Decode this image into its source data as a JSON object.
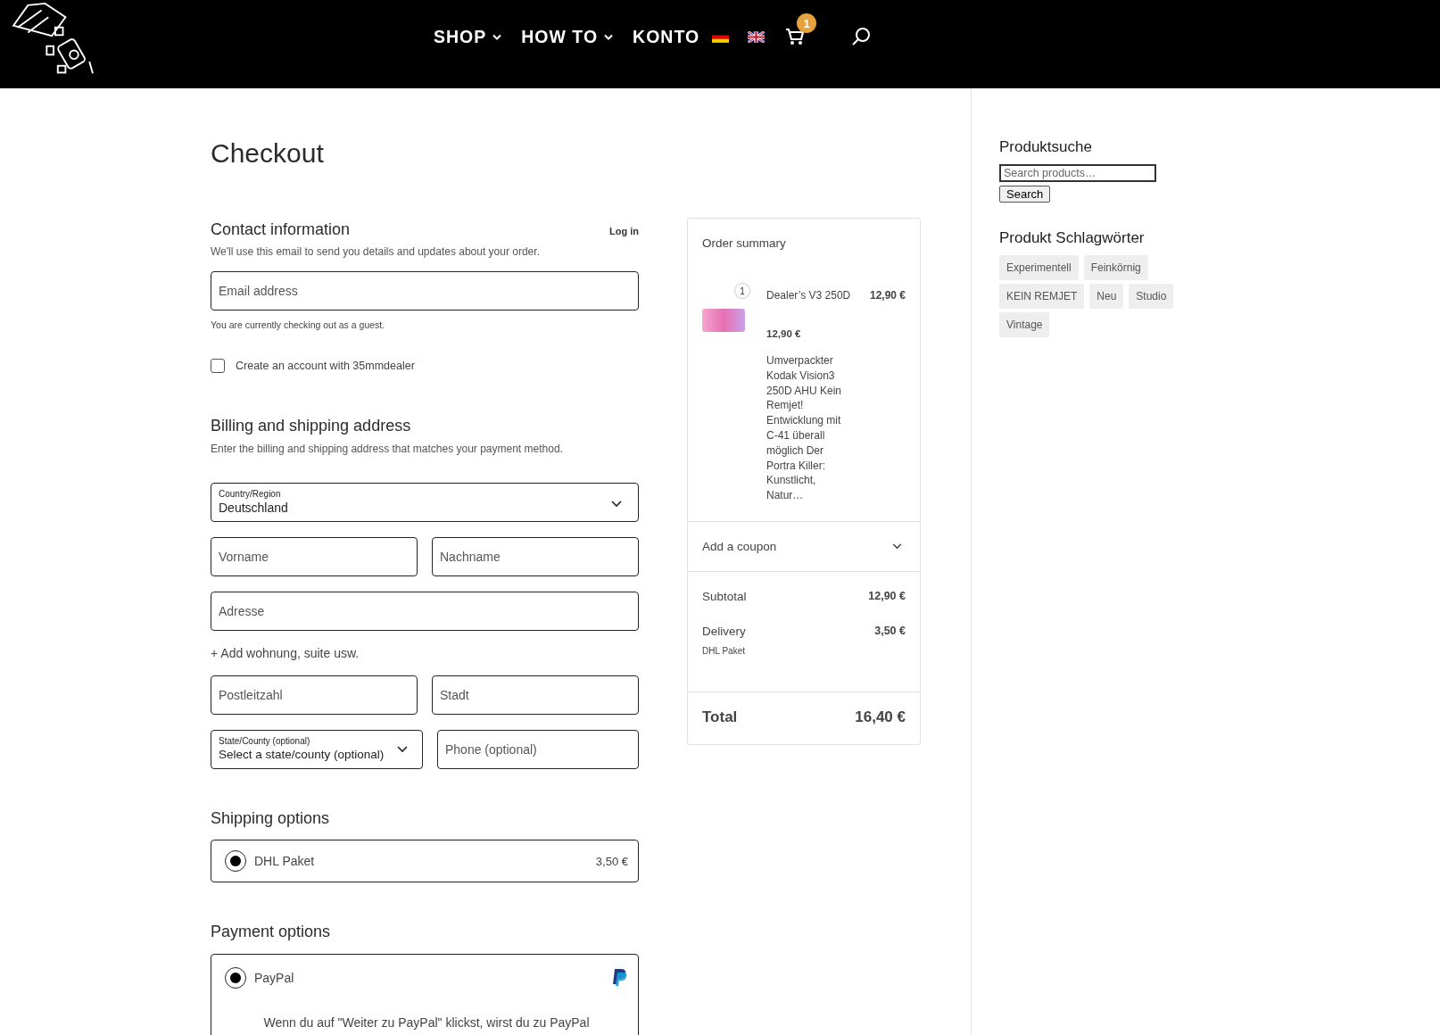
{
  "header": {
    "nav": [
      {
        "label": "SHOP",
        "kind": "dropdown"
      },
      {
        "label": "HOW TO",
        "kind": "dropdown"
      },
      {
        "label": "KONTO",
        "kind": "link"
      }
    ],
    "languages": [
      {
        "kind": "de"
      },
      {
        "kind": "uk"
      }
    ],
    "cart_count": "1"
  },
  "page_title": "Checkout",
  "contact": {
    "title": "Contact information",
    "log_in": "Log in",
    "description": "We'll use this email to send you details and updates about your order.",
    "email": {
      "placeholder": "Email address"
    },
    "guest_note": "You are currently checking out as a guest.",
    "create_account": {
      "label": "Create an account with 35mmdealer",
      "checked": false
    }
  },
  "billing": {
    "title": "Billing and shipping address",
    "description": "Enter the billing and shipping address that matches your payment method.",
    "rows": [
      [
        {
          "kind": "select",
          "label": "Country/Region",
          "value": "Deutschland"
        }
      ],
      [
        {
          "kind": "input",
          "placeholder": "Vorname"
        },
        {
          "kind": "input",
          "placeholder": "Nachname"
        }
      ],
      [
        {
          "kind": "input",
          "placeholder": "Adresse"
        }
      ],
      [
        {
          "kind": "link",
          "text": "+ Add wohnung, suite usw."
        }
      ],
      [
        {
          "kind": "input",
          "placeholder": "Postleitzahl"
        },
        {
          "kind": "input",
          "placeholder": "Stadt"
        }
      ],
      [
        {
          "kind": "select",
          "label": "State/County (optional)",
          "value": "Select a state/county (optional)"
        },
        {
          "kind": "input",
          "placeholder": "Phone (optional)"
        }
      ]
    ]
  },
  "shipping": {
    "title": "Shipping options",
    "options": [
      {
        "label": "DHL Paket",
        "price": "3,50 €",
        "selected": true
      }
    ]
  },
  "payment": {
    "title": "Payment options",
    "options": [
      {
        "label": "PayPal",
        "selected": true,
        "note": "Wenn du auf \"Weiter zu PayPal\" klickst, wirst du zu PayPal"
      }
    ]
  },
  "summary": {
    "title": "Order summary",
    "items": [
      {
        "quantity": "1",
        "name": "Dealer’s V3 250D",
        "price": "12,90 €",
        "unit_price": "12,90 €",
        "description": "Umverpackter Kodak Vision3 250D AHU Kein Remjet! Entwicklung mit C-41 überall möglich Der Portra Killer: Kunstlicht, Natur…"
      }
    ],
    "coupon": "Add a coupon",
    "subtotal": {
      "label": "Subtotal",
      "value": "12,90 €"
    },
    "delivery": {
      "label": "Delivery",
      "value": "3,50 €",
      "method": "DHL Paket"
    },
    "total": {
      "label": "Total",
      "value": "16,40 €"
    }
  },
  "sidebar": {
    "search": {
      "title": "Produktsuche",
      "placeholder": "Search products…",
      "button": "Search"
    },
    "tags": {
      "title": "Produkt Schlagwörter",
      "items": [
        "Experimentell",
        "Feinkörnig",
        "KEIN REMJET",
        "Neu",
        "Studio",
        "Vintage"
      ]
    }
  }
}
